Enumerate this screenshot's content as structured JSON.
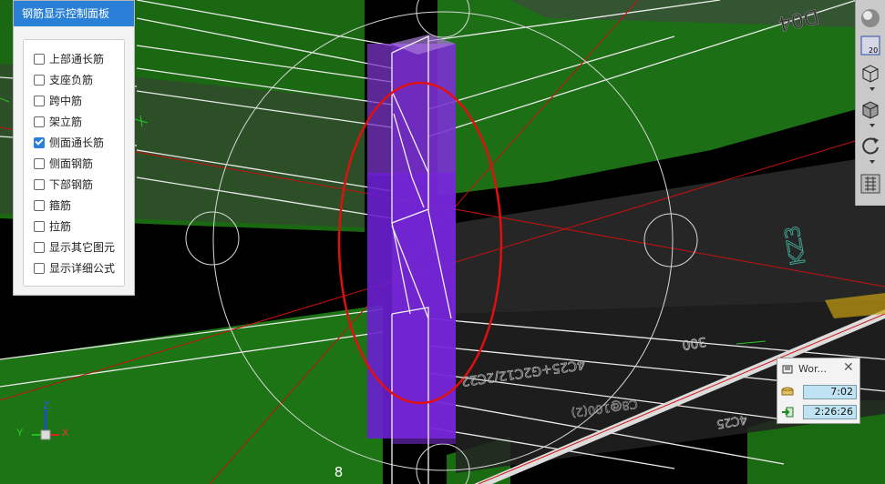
{
  "panel": {
    "title": "钢筋显示控制面板",
    "options": [
      {
        "label": "上部通长筋",
        "checked": false
      },
      {
        "label": "支座负筋",
        "checked": false
      },
      {
        "label": "跨中筋",
        "checked": false
      },
      {
        "label": "架立筋",
        "checked": false
      },
      {
        "label": "侧面通长筋",
        "checked": true
      },
      {
        "label": "侧面钢筋",
        "checked": false
      },
      {
        "label": "下部钢筋",
        "checked": false
      },
      {
        "label": "箍筋",
        "checked": false
      },
      {
        "label": "拉筋",
        "checked": false
      },
      {
        "label": "显示其它图元",
        "checked": false
      },
      {
        "label": "显示详细公式",
        "checked": false
      }
    ]
  },
  "toolbar": {
    "zoom_value": "20",
    "icons": [
      "sphere-icon",
      "top-view-icon",
      "wireframe-box-icon",
      "solid-box-icon",
      "rotate-icon",
      "dynamic-observe-icon"
    ]
  },
  "work_timer": {
    "title": "Wor...",
    "close": "✕",
    "row1_value": "7:02",
    "row2_value": "2:26:26"
  },
  "scene": {
    "grid_label": "8",
    "axis_labels": {
      "x": "X",
      "y": "Y",
      "z": "Z"
    },
    "annotations": {
      "beam_tag_top": "D04",
      "beam_tag_right": "KZ3",
      "dim_300": "300",
      "rebar_spec_left": "4C25+G2C12/2C22",
      "rebar_spec_right": "4C25",
      "rebar_spec_right2": "C8@100(2)"
    },
    "colors": {
      "background": "#000000",
      "green_slab": "#1f7a16",
      "column_purple": "#6a1fd1",
      "highlight_ellipse": "#e01010",
      "axis_line": "#c81010"
    }
  }
}
